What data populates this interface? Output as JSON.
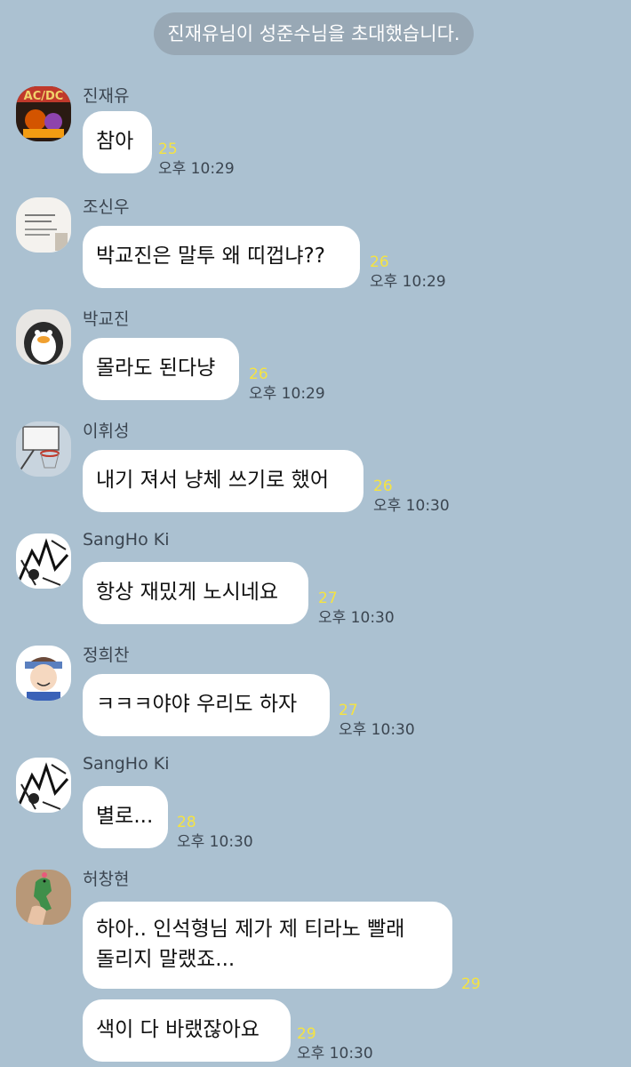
{
  "system": {
    "notice": "진재유님이 성준수님을 초대했습니다."
  },
  "messages": [
    {
      "sender": "진재유",
      "lines": [
        "참아"
      ],
      "unread": "25",
      "time": "오후 10:29"
    },
    {
      "sender": "조신우",
      "lines": [
        "박교진은 말투 왜 띠껍냐??"
      ],
      "unread": "26",
      "time": "오후 10:29"
    },
    {
      "sender": "박교진",
      "lines": [
        "몰라도 된다냥"
      ],
      "unread": "26",
      "time": "오후 10:29"
    },
    {
      "sender": "이휘성",
      "lines": [
        "내기 져서 냥체 쓰기로 했어"
      ],
      "unread": "26",
      "time": "오후 10:30"
    },
    {
      "sender": "SangHo Ki",
      "lines": [
        "항상 재밌게 노시네요"
      ],
      "unread": "27",
      "time": "오후 10:30"
    },
    {
      "sender": "정희찬",
      "lines": [
        "ㅋㅋㅋ야야 우리도 하자"
      ],
      "unread": "27",
      "time": "오후 10:30"
    },
    {
      "sender": "SangHo Ki",
      "lines": [
        "별로..."
      ],
      "unread": "28",
      "time": "오후 10:30"
    },
    {
      "sender": "허창현",
      "lines": [
        "하아.. 인석형님 제가 제 티라노 빨래",
        "돌리지 말랬죠..."
      ],
      "unread": "29",
      "time": ""
    },
    {
      "sender": "",
      "lines": [
        "색이 다 바랬잖아요"
      ],
      "unread": "29",
      "time": "오후 10:30"
    }
  ],
  "avatars": [
    "band-poster-avatar",
    "notebook-avatar",
    "penguin-plush-avatar",
    "basketball-hoop-avatar",
    "manga-sketch-avatar",
    "cartoon-boy-avatar",
    "manga-sketch-avatar",
    "dinosaur-toy-avatar"
  ]
}
